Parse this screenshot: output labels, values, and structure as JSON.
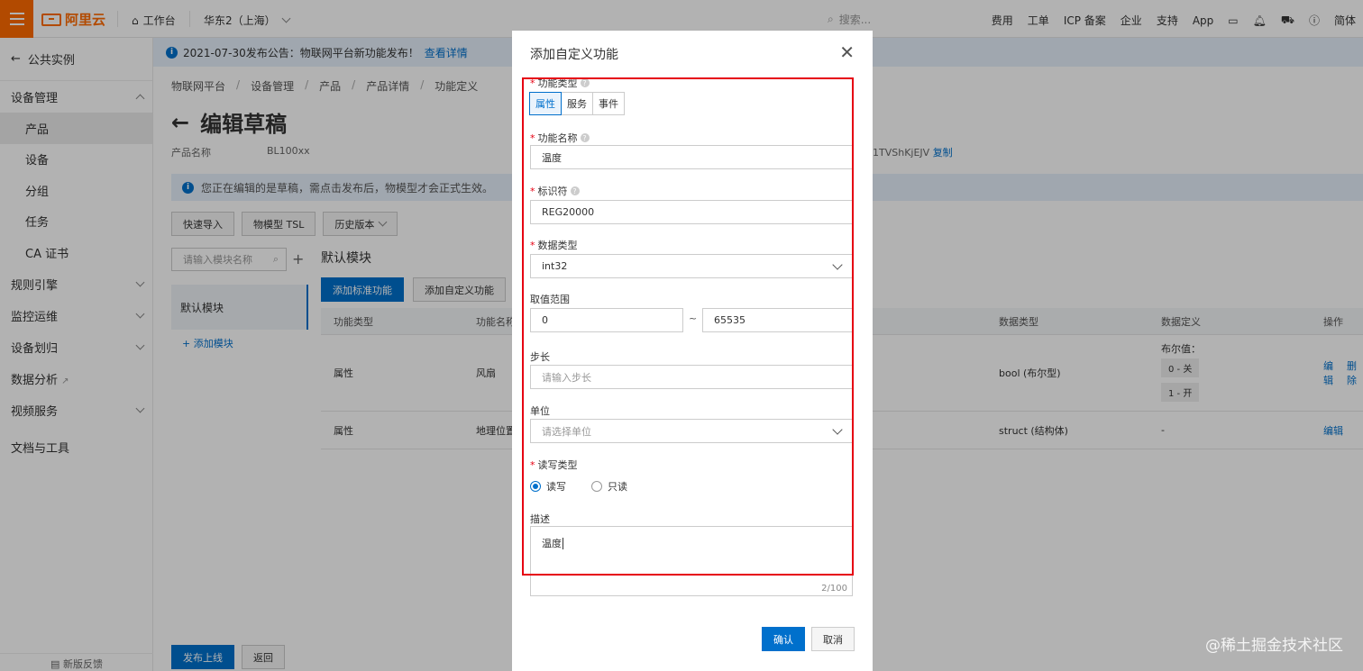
{
  "topbar": {
    "brand": "阿里云",
    "workbench": "工作台",
    "region": "华东2（上海）",
    "search_placeholder": "搜索...",
    "nav": [
      "费用",
      "工单",
      "ICP 备案",
      "企业",
      "支持",
      "App"
    ],
    "lang": "简体"
  },
  "sidebar": {
    "back": "公共实例",
    "groups": [
      {
        "label": "设备管理",
        "expanded": true,
        "items": [
          "产品",
          "设备",
          "分组",
          "任务",
          "CA 证书"
        ],
        "active": "产品"
      },
      {
        "label": "规则引擎"
      },
      {
        "label": "监控运维"
      },
      {
        "label": "设备划归"
      },
      {
        "label": "数据分析"
      },
      {
        "label": "视频服务"
      },
      {
        "label": "文档与工具"
      }
    ],
    "footer": "新版反馈"
  },
  "main": {
    "notice": "2021-07-30发布公告：物联网平台新功能发布！",
    "notice_link": "查看详情",
    "breadcrumb": [
      "物联网平台",
      "设备管理",
      "产品",
      "产品详情",
      "功能定义"
    ],
    "title": "编辑草稿",
    "product_label": "产品名称",
    "product_name": "BL100xx",
    "product_key_tail": "1TVShKjEJV",
    "copy": "复制",
    "draft_notice": "您正在编辑的是草稿，需点击发布后，物模型才会正式生效。",
    "buttons": {
      "quick_import": "快速导入",
      "tsl": "物模型 TSL",
      "history": "历史版本"
    },
    "module_search_placeholder": "请输入模块名称",
    "module_list": [
      "默认模块"
    ],
    "add_module": "+ 添加模块",
    "module_title": "默认模块",
    "add_standard": "添加标准功能",
    "add_custom": "添加自定义功能",
    "table": {
      "headers": [
        "功能类型",
        "功能名称（全部）",
        "数据类型",
        "数据定义",
        "操作"
      ],
      "rows": [
        {
          "type": "属性",
          "name": "风扇",
          "dtype": "bool (布尔型)",
          "def_title": "布尔值：",
          "defs": [
            "0 - 关",
            "1 - 开"
          ],
          "ops": [
            "编辑",
            "删除"
          ]
        },
        {
          "type": "属性",
          "name": "地理位置",
          "dtype": "struct (结构体)",
          "def_title": "-",
          "defs": [],
          "ops": [
            "编辑"
          ]
        }
      ]
    },
    "publish": "发布上线",
    "back": "返回"
  },
  "modal": {
    "title": "添加自定义功能",
    "fields": {
      "func_type_label": "功能类型",
      "func_types": [
        "属性",
        "服务",
        "事件"
      ],
      "func_type_selected": "属性",
      "name_label": "功能名称",
      "name_value": "温度",
      "id_label": "标识符",
      "id_value": "REG20000",
      "dtype_label": "数据类型",
      "dtype_value": "int32",
      "range_label": "取值范围",
      "range_min": "0",
      "range_sep": "~",
      "range_max": "65535",
      "step_label": "步长",
      "step_placeholder": "请输入步长",
      "unit_label": "单位",
      "unit_placeholder": "请选择单位",
      "rw_label": "读写类型",
      "rw_options": [
        "读写",
        "只读"
      ],
      "rw_selected": "读写",
      "desc_label": "描述",
      "desc_value": "温度",
      "desc_count": "2/100"
    },
    "confirm": "确认",
    "cancel": "取消"
  },
  "watermark": "@稀土掘金技术社区",
  "colors": {
    "brand": "#ff6a00",
    "primary": "#0070cc",
    "highlight": "#e60012"
  }
}
